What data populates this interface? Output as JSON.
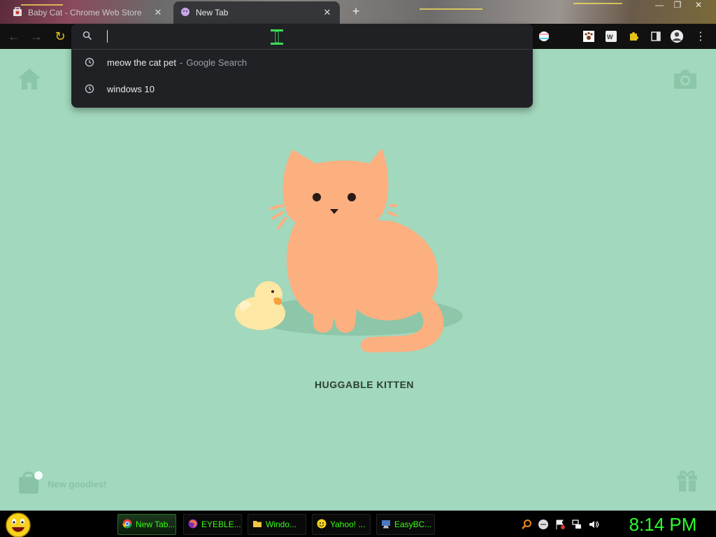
{
  "tabs": [
    {
      "title": "Baby Cat - Chrome Web Store",
      "favicon": "chrome-web-store-icon",
      "active": false
    },
    {
      "title": "New Tab",
      "favicon": "cat-face-icon",
      "active": true
    }
  ],
  "omnibox": {
    "value": "",
    "suggestions": [
      {
        "icon": "history-clock-icon",
        "text": "meow the cat pet",
        "separator": "-",
        "source": "Google Search"
      },
      {
        "icon": "history-clock-icon",
        "text": "windows 10",
        "separator": "",
        "source": ""
      }
    ]
  },
  "page": {
    "cat_name": "HUGGABLE KITTEN",
    "goodies_label": "New goodies!",
    "accent_background": "#a2d8bd",
    "cat_color": "#fcaf7f",
    "duck_color": "#fde7a4"
  },
  "taskbar": {
    "items": [
      {
        "label": "New Tab...",
        "icon": "chrome-icon"
      },
      {
        "label": "EYEBLE...",
        "icon": "firefox-icon"
      },
      {
        "label": "Windo...",
        "icon": "folder-icon"
      },
      {
        "label": "Yahoo! ...",
        "icon": "yahoo-smiley-icon"
      },
      {
        "label": "EasyBC...",
        "icon": "easybcd-icon"
      }
    ],
    "clock": "8:14 PM"
  }
}
